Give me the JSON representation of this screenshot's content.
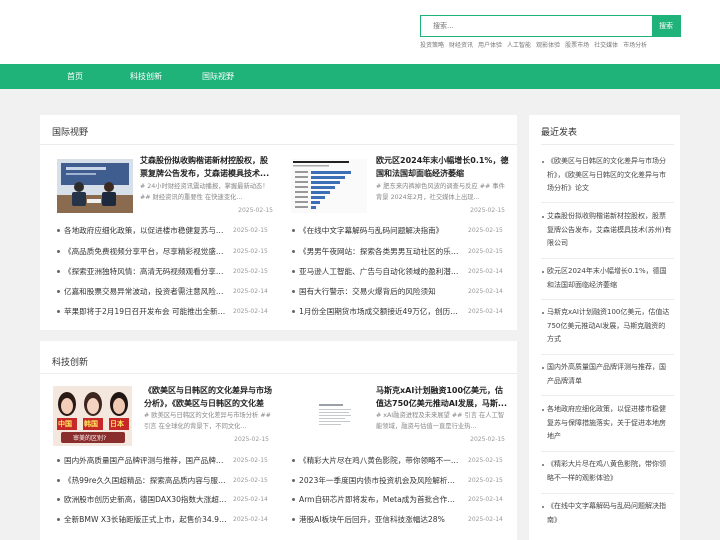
{
  "search": {
    "placeholder": "搜索...",
    "button": "搜索"
  },
  "hotwords": [
    "投资策略",
    "财经资讯",
    "用户体验",
    "人工智能",
    "观影体验",
    "股票市场",
    "社交媒体",
    "市场分析"
  ],
  "nav": [
    "首页",
    "科技创新",
    "国际视野"
  ],
  "intl": {
    "title": "国际视野",
    "feat1": {
      "title": "艾森股份拟收购楷诺新材控股权，股票复牌公告发布，艾森诺模具技术...",
      "desc": "# 24小时财经资讯震动播报，掌握最新动态！ ## 财经资讯的重要性 在快速变化...",
      "date": "2025-02-15"
    },
    "feat2": {
      "title": "欧元区2024年末小幅增长0.1%，德国和法国却面临经济萎缩",
      "desc": "# 肥东来内裤掉色风波的调查与反应 ## 事件背景 2024年2月，社交媒体上出现...",
      "date": "2025-02-15"
    },
    "left": [
      {
        "text": "各地政府应细化政策，以促进楼市稳健复苏与保障...",
        "date": "2025-02-15"
      },
      {
        "text": "《高品质免费视频分享平台，尽享精彩视觉盛宴...",
        "date": "2025-02-15"
      },
      {
        "text": "《探索亚洲独特风情：高清无码视频观看分享平...",
        "date": "2025-02-15"
      },
      {
        "text": "亿嘉和股票交易异常波动，投资者需注意风险提...",
        "date": "2025-02-14"
      },
      {
        "text": "苹果即将于2月19日召开发布会 可能推出全新iP...",
        "date": "2025-02-14"
      }
    ],
    "right": [
      {
        "text": "《在线中文字幕解码与乱码问题解决指南》",
        "date": "2025-02-15"
      },
      {
        "text": "《男男午夜网站：探索各类男男互动社区的乐趣...",
        "date": "2025-02-15"
      },
      {
        "text": "亚马逊人工智能、广告与自动化领域的盈利潜力...",
        "date": "2025-02-14"
      },
      {
        "text": "国有大行警示：交易火爆背后的风险须知",
        "date": "2025-02-14"
      },
      {
        "text": "1月份全国期货市场成交额接近49万亿，创历史...",
        "date": "2025-02-14"
      }
    ]
  },
  "tech": {
    "title": "科技创新",
    "poster_text": [
      "中国",
      "韩国",
      "日本"
    ],
    "poster_caption": "审美的区别?",
    "feat1": {
      "title": "《欧美区与日韩区的文化差异与市场分析》，《欧美区与日韩区的文化差异...",
      "desc": "# 欧美区与日韩区的文化差异与市场分析 ## 引言 在全球化的背景下，不同文化...",
      "date": "2025-02-15"
    },
    "feat2": {
      "title": "马斯克xAI计划融资100亿美元，估值达750亿美元推动AI发展，马斯...",
      "desc": "# xAI融资进程及未来展望 ## 引言 在人工智能领域，融资与估值一直是行业热...",
      "date": "2025-02-15"
    },
    "left": [
      {
        "text": "国内外高质量国产品牌评测与推荐，国产品牌清单",
        "date": "2025-02-15"
      },
      {
        "text": "《热99re久久国超精品：探索高品质内容与服务...",
        "date": "2025-02-15"
      },
      {
        "text": "欧洲股市创历史新高，德国DAX30指数大涨超2%",
        "date": "2025-02-14"
      },
      {
        "text": "全新BMW X3长轴距版正式上市，起售价34.99...",
        "date": "2025-02-14"
      }
    ],
    "right": [
      {
        "text": "《精彩大片尽在鸡八黄色影院，带你领略不一样...",
        "date": "2025-02-15"
      },
      {
        "text": "2023年一季度国内债市投资机会及风险解析，2...",
        "date": "2025-02-15"
      },
      {
        "text": "Arm自研芯片即将发布，Meta成为首批合作客户...",
        "date": "2025-02-14"
      },
      {
        "text": "港股AI板块午后回升，亚信科技涨幅达28%",
        "date": "2025-02-14"
      }
    ]
  },
  "sidebar": {
    "title": "最近发表",
    "items": [
      "《欧美区与日韩区的文化差异与市场分析》，《欧美区与日韩区的文化差异与市场分析》论文",
      "艾森股份拟收购楷诺新材控股权，股票复牌公告发布，艾森诺模具技术(苏州)有限公司",
      "欧元区2024年末小幅增长0.1%，德国和法国却面临经济萎缩",
      "马斯克xAI计划融资100亿美元，估值达750亿美元推动AI发展，马斯克融资的方式",
      "国内外高质量国产品牌评测与推荐，国产品牌清单",
      "各地政府应细化政策，以促进楼市稳健复苏与保障措施落实，关于促进本地房地产",
      "《精彩大片尽在鸡八黄色影院，带你领略不一样的观影体验》",
      "《在线中文字幕解码与乱码问题解决指南》"
    ]
  },
  "colors": {
    "accent": "#1fb37a",
    "background": "#f1f1f1"
  }
}
